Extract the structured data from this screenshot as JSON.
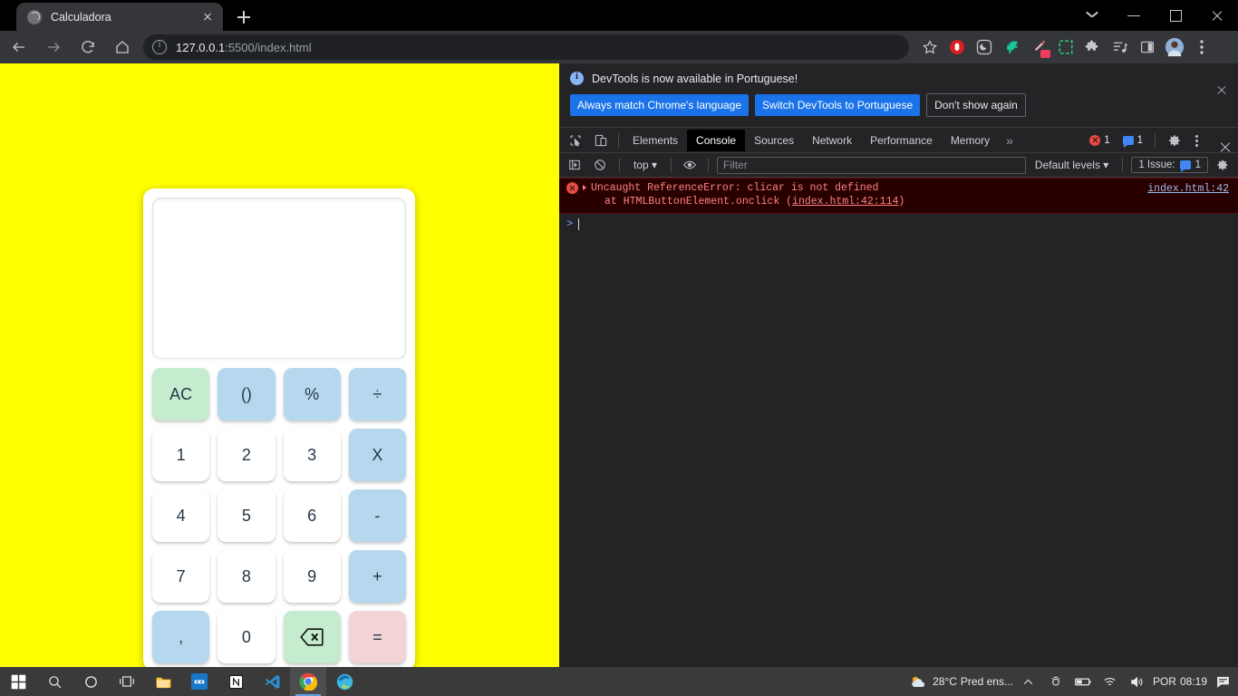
{
  "browser": {
    "tab": {
      "title": "Calculadora",
      "favicon": "globe-icon"
    },
    "new_tab_label": "+",
    "window_controls": [
      "tab-search-chevron",
      "minimize",
      "maximize",
      "close"
    ],
    "nav": [
      "back-arrow",
      "forward-arrow",
      "reload",
      "home"
    ],
    "omnibox": {
      "security_icon": "info-circle-icon",
      "url_host": "127.0.0.1",
      "url_rest": ":5500/index.html",
      "full_url": "127.0.0.1:5500/index.html"
    },
    "toolbar_icons": [
      "bookmark-star-icon",
      "adblock-icon",
      "dark-reader-icon",
      "dino-extension-icon",
      "wand-extension-icon",
      "screenshot-extension-icon",
      "puzzle-extensions-icon",
      "reading-list-icon",
      "side-panel-icon",
      "profile-avatar",
      "chrome-menu-icon"
    ]
  },
  "page": {
    "background_color": "#ffff00",
    "calculator": {
      "display_value": "",
      "keys": [
        {
          "label": "AC",
          "kind": "fn",
          "name": "all-clear"
        },
        {
          "label": "()",
          "kind": "op",
          "name": "parentheses"
        },
        {
          "label": "%",
          "kind": "op",
          "name": "percent"
        },
        {
          "label": "÷",
          "kind": "op",
          "name": "divide"
        },
        {
          "label": "1",
          "kind": "num",
          "name": "digit-1"
        },
        {
          "label": "2",
          "kind": "num",
          "name": "digit-2"
        },
        {
          "label": "3",
          "kind": "num",
          "name": "digit-3"
        },
        {
          "label": "X",
          "kind": "op",
          "name": "multiply"
        },
        {
          "label": "4",
          "kind": "num",
          "name": "digit-4"
        },
        {
          "label": "5",
          "kind": "num",
          "name": "digit-5"
        },
        {
          "label": "6",
          "kind": "num",
          "name": "digit-6"
        },
        {
          "label": "-",
          "kind": "op",
          "name": "minus"
        },
        {
          "label": "7",
          "kind": "num",
          "name": "digit-7"
        },
        {
          "label": "8",
          "kind": "num",
          "name": "digit-8"
        },
        {
          "label": "9",
          "kind": "num",
          "name": "digit-9"
        },
        {
          "label": "+",
          "kind": "op",
          "name": "plus"
        },
        {
          "label": ",",
          "kind": "op",
          "name": "decimal-comma"
        },
        {
          "label": "0",
          "kind": "num",
          "name": "digit-0"
        },
        {
          "label": "⌫",
          "kind": "fn",
          "name": "backspace"
        },
        {
          "label": "=",
          "kind": "eq",
          "name": "equals"
        }
      ],
      "colors": {
        "number": "#ffffff",
        "operator": "#b6d8ee",
        "function": "#c5ecce",
        "equals": "#f2d4d7"
      }
    }
  },
  "devtools": {
    "banner": {
      "message": "DevTools is now available in Portuguese!",
      "primary_1": "Always match Chrome's language",
      "primary_2": "Switch DevTools to Portuguese",
      "ghost": "Don't show again",
      "close": "close-icon"
    },
    "tools": [
      "inspect-element-icon",
      "device-toolbar-icon"
    ],
    "tabs": [
      {
        "label": "Elements",
        "active": false
      },
      {
        "label": "Console",
        "active": true
      },
      {
        "label": "Sources",
        "active": false
      },
      {
        "label": "Network",
        "active": false
      },
      {
        "label": "Performance",
        "active": false
      },
      {
        "label": "Memory",
        "active": false
      }
    ],
    "more_tabs": "»",
    "counters": {
      "errors": "1",
      "messages": "1"
    },
    "filterbar": {
      "context": "top",
      "filter_placeholder": "Filter",
      "levels": "Default levels",
      "issues_label": "1 Issue:",
      "issues_count": "1"
    },
    "console": {
      "error_message": "Uncaught ReferenceError: clicar is not defined",
      "error_stack": "at HTMLButtonElement.onclick (index.html:42:114)",
      "error_stack_prefix": "at HTMLButtonElement.onclick (",
      "error_stack_link": "index.html:42:114",
      "error_stack_suffix": ")",
      "error_source": "index.html:42",
      "prompt": ">"
    }
  },
  "taskbar": {
    "items": [
      "start-icon",
      "search-icon",
      "cortana-icon",
      "task-view-icon",
      "file-explorer-icon",
      "blue-app-icon",
      "notion-icon",
      "vscode-icon",
      "chrome-icon",
      "edge-icon"
    ],
    "tray": {
      "weather_temp": "28°C",
      "weather_text": "Pred ens...",
      "chevron": "show-hidden-icons",
      "icons": [
        "camera-icon",
        "battery-icon",
        "wifi-icon",
        "volume-icon"
      ],
      "language": "POR",
      "clock": "08:19",
      "notifications": "notification-icon"
    }
  }
}
